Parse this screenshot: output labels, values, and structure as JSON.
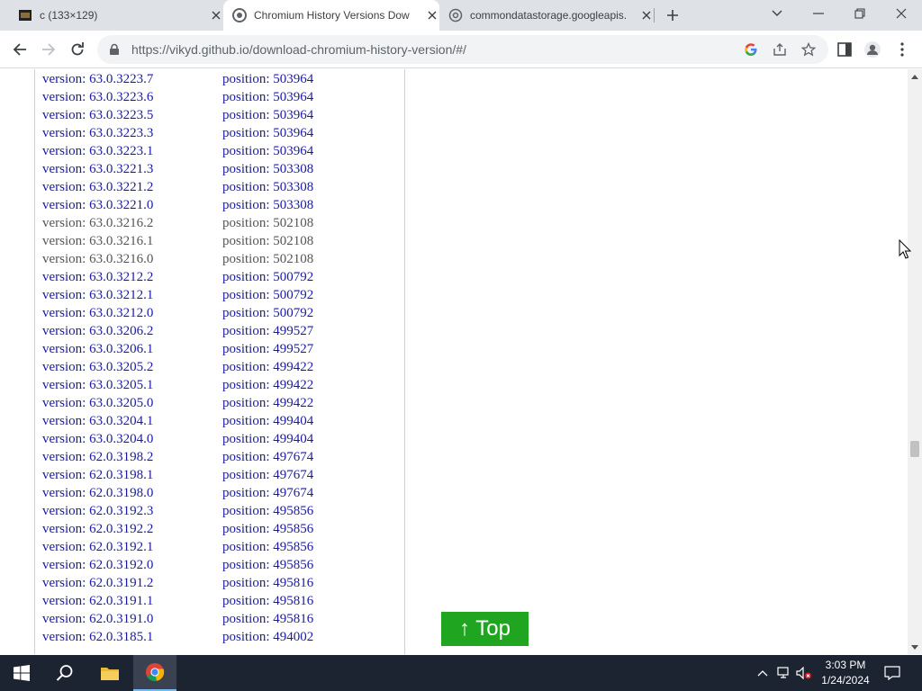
{
  "browser": {
    "tabs": [
      {
        "title": "c (133×129)"
      },
      {
        "title": "Chromium History Versions Dow"
      },
      {
        "title": "commondatastorage.googleapis."
      }
    ],
    "url": "https://vikyd.github.io/download-chromium-history-version/#/"
  },
  "page": {
    "rows": [
      {
        "version": "version: 63.0.3223.7",
        "position": "position: 503964"
      },
      {
        "version": "version: 63.0.3223.6",
        "position": "position: 503964"
      },
      {
        "version": "version: 63.0.3223.5",
        "position": "position: 503964"
      },
      {
        "version": "version: 63.0.3223.3",
        "position": "position: 503964"
      },
      {
        "version": "version: 63.0.3223.1",
        "position": "position: 503964"
      },
      {
        "version": "version: 63.0.3221.3",
        "position": "position: 503308"
      },
      {
        "version": "version: 63.0.3221.2",
        "position": "position: 503308"
      },
      {
        "version": "version: 63.0.3221.0",
        "position": "position: 503308"
      },
      {
        "version": "version: 63.0.3216.2",
        "position": "position: 502108"
      },
      {
        "version": "version: 63.0.3216.1",
        "position": "position: 502108"
      },
      {
        "version": "version: 63.0.3216.0",
        "position": "position: 502108"
      },
      {
        "version": "version: 63.0.3212.2",
        "position": "position: 500792"
      },
      {
        "version": "version: 63.0.3212.1",
        "position": "position: 500792"
      },
      {
        "version": "version: 63.0.3212.0",
        "position": "position: 500792"
      },
      {
        "version": "version: 63.0.3206.2",
        "position": "position: 499527"
      },
      {
        "version": "version: 63.0.3206.1",
        "position": "position: 499527"
      },
      {
        "version": "version: 63.0.3205.2",
        "position": "position: 499422"
      },
      {
        "version": "version: 63.0.3205.1",
        "position": "position: 499422"
      },
      {
        "version": "version: 63.0.3205.0",
        "position": "position: 499422"
      },
      {
        "version": "version: 63.0.3204.1",
        "position": "position: 499404"
      },
      {
        "version": "version: 63.0.3204.0",
        "position": "position: 499404"
      },
      {
        "version": "version: 62.0.3198.2",
        "position": "position: 497674"
      },
      {
        "version": "version: 62.0.3198.1",
        "position": "position: 497674"
      },
      {
        "version": "version: 62.0.3198.0",
        "position": "position: 497674"
      },
      {
        "version": "version: 62.0.3192.3",
        "position": "position: 495856"
      },
      {
        "version": "version: 62.0.3192.2",
        "position": "position: 495856"
      },
      {
        "version": "version: 62.0.3192.1",
        "position": "position: 495856"
      },
      {
        "version": "version: 62.0.3192.0",
        "position": "position: 495856"
      },
      {
        "version": "version: 62.0.3191.2",
        "position": "position: 495816"
      },
      {
        "version": "version: 62.0.3191.1",
        "position": "position: 495816"
      },
      {
        "version": "version: 62.0.3191.0",
        "position": "position: 495816"
      },
      {
        "version": "version: 62.0.3185.1",
        "position": "position: 494002"
      }
    ],
    "top_button": "↑ Top"
  },
  "taskbar": {
    "time": "3:03 PM",
    "date": "1/24/2024"
  },
  "colors": {
    "link": "#1a1aa6",
    "visited": "#555555",
    "top_button": "#1fa51f",
    "taskbar": "#1c2431"
  }
}
